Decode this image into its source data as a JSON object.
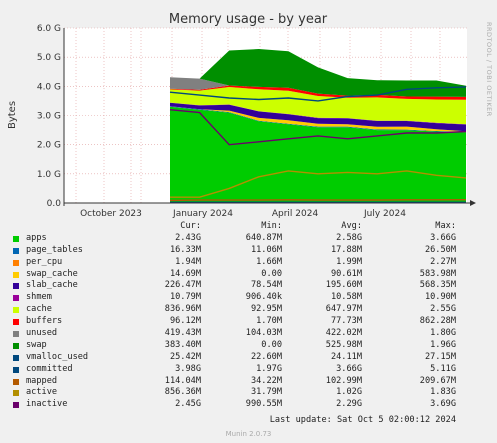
{
  "chart_data": {
    "type": "area",
    "title": "Memory usage - by year",
    "ylabel": "Bytes",
    "side_label": "RRDTOOL / TOBI OETIKER",
    "ylim": [
      0,
      6.0
    ],
    "y_unit": "G",
    "y_ticks": [
      "0.0",
      "1.0 G",
      "2.0 G",
      "3.0 G",
      "4.0 G",
      "5.0 G",
      "6.0 G"
    ],
    "x_ticks": [
      "October 2023",
      "January 2024",
      "April 2024",
      "July 2024"
    ],
    "grid": true,
    "series": [
      {
        "name": "apps",
        "color": "#00cc00",
        "values": [
          3.3,
          3.2,
          3.1,
          2.8,
          2.7,
          2.6,
          2.6,
          2.5,
          2.5,
          2.45,
          2.43
        ]
      },
      {
        "name": "page_tables",
        "color": "#0066b3",
        "values": [
          0.012,
          0.012,
          0.015,
          0.017,
          0.018,
          0.018,
          0.019,
          0.019,
          0.018,
          0.017,
          0.016
        ]
      },
      {
        "name": "per_cpu",
        "color": "#ff8000",
        "values": [
          0.002,
          0.002,
          0.002,
          0.002,
          0.002,
          0.002,
          0.002,
          0.002,
          0.002,
          0.002,
          0.002
        ]
      },
      {
        "name": "swap_cache",
        "color": "#ffcc00",
        "values": [
          0.0,
          0.0,
          0.05,
          0.1,
          0.12,
          0.1,
          0.08,
          0.09,
          0.1,
          0.06,
          0.015
        ]
      },
      {
        "name": "slab_cache",
        "color": "#330099",
        "values": [
          0.12,
          0.13,
          0.2,
          0.22,
          0.2,
          0.19,
          0.2,
          0.2,
          0.19,
          0.21,
          0.23
        ]
      },
      {
        "name": "shmem",
        "color": "#990099",
        "values": [
          0.01,
          0.01,
          0.01,
          0.01,
          0.01,
          0.01,
          0.01,
          0.01,
          0.01,
          0.01,
          0.01
        ]
      },
      {
        "name": "cache",
        "color": "#ccff00",
        "values": [
          0.45,
          0.5,
          0.6,
          0.75,
          0.8,
          0.75,
          0.7,
          0.8,
          0.75,
          0.8,
          0.84
        ]
      },
      {
        "name": "buffers",
        "color": "#ff0000",
        "values": [
          0.02,
          0.03,
          0.05,
          0.08,
          0.1,
          0.08,
          0.07,
          0.09,
          0.08,
          0.1,
          0.096
        ]
      },
      {
        "name": "unused",
        "color": "#808080",
        "values": [
          0.4,
          0.38,
          0.0,
          0.0,
          0.0,
          0.0,
          0.0,
          0.0,
          0.0,
          0.0,
          0.0
        ]
      },
      {
        "name": "swap",
        "color": "#008f00",
        "values": [
          0.0,
          0.0,
          1.2,
          1.3,
          1.25,
          0.9,
          0.6,
          0.5,
          0.55,
          0.55,
          0.38
        ]
      },
      {
        "name": "vmalloc_used",
        "color": "#00487d",
        "values": [
          0.024,
          0.024,
          0.024,
          0.024,
          0.024,
          0.024,
          0.024,
          0.024,
          0.024,
          0.025,
          0.025
        ]
      },
      {
        "name": "committed",
        "color": "#00487d",
        "values": [
          3.8,
          3.7,
          3.6,
          3.55,
          3.6,
          3.5,
          3.65,
          3.7,
          3.9,
          3.95,
          3.98
        ]
      },
      {
        "name": "mapped",
        "color": "#b35a00",
        "values": [
          0.09,
          0.1,
          0.1,
          0.1,
          0.11,
          0.1,
          0.1,
          0.1,
          0.11,
          0.11,
          0.114
        ]
      },
      {
        "name": "active",
        "color": "#b38f00",
        "values": [
          0.2,
          0.2,
          0.5,
          0.9,
          1.1,
          1.0,
          1.05,
          1.0,
          1.1,
          0.95,
          0.86
        ]
      },
      {
        "name": "inactive",
        "color": "#6b006b",
        "values": [
          3.2,
          3.1,
          2.0,
          2.1,
          2.2,
          2.3,
          2.2,
          2.3,
          2.4,
          2.4,
          2.45
        ]
      }
    ]
  },
  "legend": {
    "headers": [
      "Cur:",
      "Min:",
      "Avg:",
      "Max:"
    ],
    "rows": [
      {
        "name": "apps",
        "color": "#00cc00",
        "cur": "2.43G",
        "min": "640.87M",
        "avg": "2.58G",
        "max": "3.66G"
      },
      {
        "name": "page_tables",
        "color": "#0066b3",
        "cur": "16.33M",
        "min": "11.06M",
        "avg": "17.88M",
        "max": "26.50M"
      },
      {
        "name": "per_cpu",
        "color": "#ff8000",
        "cur": "1.94M",
        "min": "1.66M",
        "avg": "1.99M",
        "max": "2.27M"
      },
      {
        "name": "swap_cache",
        "color": "#ffcc00",
        "cur": "14.69M",
        "min": "0.00",
        "avg": "90.61M",
        "max": "583.98M"
      },
      {
        "name": "slab_cache",
        "color": "#330099",
        "cur": "226.47M",
        "min": "78.54M",
        "avg": "195.60M",
        "max": "568.35M"
      },
      {
        "name": "shmem",
        "color": "#990099",
        "cur": "10.79M",
        "min": "906.40k",
        "avg": "10.58M",
        "max": "10.90M"
      },
      {
        "name": "cache",
        "color": "#ccff00",
        "cur": "836.96M",
        "min": "92.95M",
        "avg": "647.97M",
        "max": "2.55G"
      },
      {
        "name": "buffers",
        "color": "#ff0000",
        "cur": "96.12M",
        "min": "1.70M",
        "avg": "77.73M",
        "max": "862.28M"
      },
      {
        "name": "unused",
        "color": "#808080",
        "cur": "419.43M",
        "min": "104.03M",
        "avg": "422.02M",
        "max": "1.80G"
      },
      {
        "name": "swap",
        "color": "#008f00",
        "cur": "383.40M",
        "min": "0.00",
        "avg": "525.98M",
        "max": "1.96G"
      },
      {
        "name": "vmalloc_used",
        "color": "#00487d",
        "cur": "25.42M",
        "min": "22.60M",
        "avg": "24.11M",
        "max": "27.15M"
      },
      {
        "name": "committed",
        "color": "#00487d",
        "cur": "3.98G",
        "min": "1.97G",
        "avg": "3.66G",
        "max": "5.11G"
      },
      {
        "name": "mapped",
        "color": "#b35a00",
        "cur": "114.04M",
        "min": "34.22M",
        "avg": "102.99M",
        "max": "209.67M"
      },
      {
        "name": "active",
        "color": "#b38f00",
        "cur": "856.36M",
        "min": "31.79M",
        "avg": "1.02G",
        "max": "1.83G"
      },
      {
        "name": "inactive",
        "color": "#6b006b",
        "cur": "2.45G",
        "min": "990.55M",
        "avg": "2.29G",
        "max": "3.69G"
      }
    ]
  },
  "last_update": "Last update:  Sat Oct  5 02:00:12 2024",
  "footer": "Munin 2.0.73"
}
